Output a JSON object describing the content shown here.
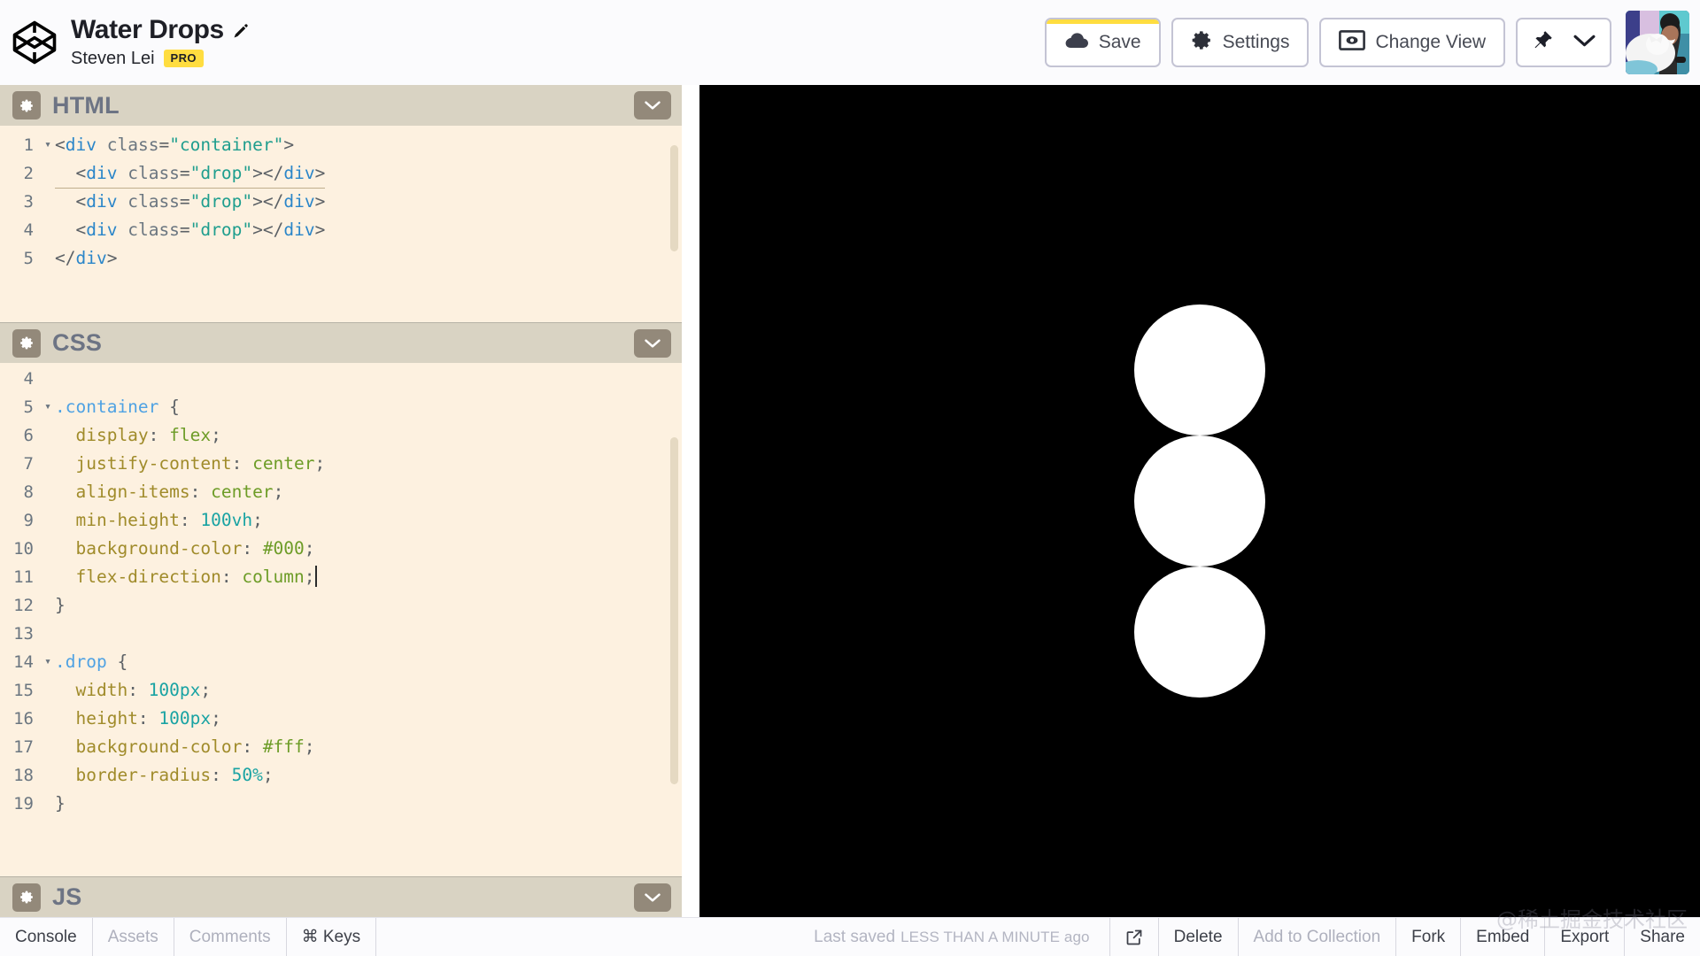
{
  "header": {
    "logo_icon": "codepen-logo-icon",
    "pen_title": "Water Drops",
    "edit_icon": "pencil-edit-icon",
    "author": "Steven Lei",
    "pro_badge": "PRO",
    "buttons": {
      "save": {
        "label": "Save",
        "icon": "cloud-icon",
        "unsaved_accent": "#ffdd40"
      },
      "settings": {
        "label": "Settings",
        "icon": "gear-icon"
      },
      "change_view": {
        "label": "Change View",
        "icon": "eye-in-frame-icon"
      },
      "pin": {
        "icon": "pin-icon",
        "chevron": "chevron-down-icon"
      }
    },
    "avatar_alt": "user-avatar"
  },
  "editors": [
    {
      "name": "HTML",
      "gear_icon": "gear-icon",
      "collapse_icon": "chevron-down-icon",
      "lines": [
        {
          "num": "1",
          "fold": "▾",
          "tokens": [
            {
              "t": "punct",
              "v": "<"
            },
            {
              "t": "tag",
              "v": "div"
            },
            {
              "t": "punct",
              "v": " "
            },
            {
              "t": "attr",
              "v": "class"
            },
            {
              "t": "punct",
              "v": "="
            },
            {
              "t": "str",
              "v": "\"container\""
            },
            {
              "t": "punct",
              "v": ">"
            }
          ]
        },
        {
          "num": "2",
          "fold": "",
          "underline": true,
          "tokens": [
            {
              "t": "punct",
              "v": "  <"
            },
            {
              "t": "tag",
              "v": "div"
            },
            {
              "t": "punct",
              "v": " "
            },
            {
              "t": "attr",
              "v": "class"
            },
            {
              "t": "punct",
              "v": "="
            },
            {
              "t": "str",
              "v": "\"drop\""
            },
            {
              "t": "punct",
              "v": "></"
            },
            {
              "t": "tag",
              "v": "div"
            },
            {
              "t": "punct",
              "v": ">"
            }
          ]
        },
        {
          "num": "3",
          "fold": "",
          "tokens": [
            {
              "t": "punct",
              "v": "  <"
            },
            {
              "t": "tag",
              "v": "div"
            },
            {
              "t": "punct",
              "v": " "
            },
            {
              "t": "attr",
              "v": "class"
            },
            {
              "t": "punct",
              "v": "="
            },
            {
              "t": "str",
              "v": "\"drop\""
            },
            {
              "t": "punct",
              "v": "></"
            },
            {
              "t": "tag",
              "v": "div"
            },
            {
              "t": "punct",
              "v": ">"
            }
          ]
        },
        {
          "num": "4",
          "fold": "",
          "tokens": [
            {
              "t": "punct",
              "v": "  <"
            },
            {
              "t": "tag",
              "v": "div"
            },
            {
              "t": "punct",
              "v": " "
            },
            {
              "t": "attr",
              "v": "class"
            },
            {
              "t": "punct",
              "v": "="
            },
            {
              "t": "str",
              "v": "\"drop\""
            },
            {
              "t": "punct",
              "v": "></"
            },
            {
              "t": "tag",
              "v": "div"
            },
            {
              "t": "punct",
              "v": ">"
            }
          ]
        },
        {
          "num": "5",
          "fold": "",
          "tokens": [
            {
              "t": "punct",
              "v": "</"
            },
            {
              "t": "tag",
              "v": "div"
            },
            {
              "t": "punct",
              "v": ">"
            }
          ]
        }
      ]
    },
    {
      "name": "CSS",
      "gear_icon": "gear-icon",
      "collapse_icon": "chevron-down-icon",
      "lines": [
        {
          "num": "4",
          "fold": "",
          "tokens": []
        },
        {
          "num": "5",
          "fold": "▾",
          "tokens": [
            {
              "t": "sel",
              "v": ".container"
            },
            {
              "t": "punct",
              "v": " {"
            }
          ]
        },
        {
          "num": "6",
          "fold": "",
          "tokens": [
            {
              "t": "prop",
              "v": "  display"
            },
            {
              "t": "punct",
              "v": ": "
            },
            {
              "t": "val",
              "v": "flex"
            },
            {
              "t": "punct",
              "v": ";"
            }
          ]
        },
        {
          "num": "7",
          "fold": "",
          "tokens": [
            {
              "t": "prop",
              "v": "  justify-content"
            },
            {
              "t": "punct",
              "v": ": "
            },
            {
              "t": "val",
              "v": "center"
            },
            {
              "t": "punct",
              "v": ";"
            }
          ]
        },
        {
          "num": "8",
          "fold": "",
          "tokens": [
            {
              "t": "prop",
              "v": "  align-items"
            },
            {
              "t": "punct",
              "v": ": "
            },
            {
              "t": "val",
              "v": "center"
            },
            {
              "t": "punct",
              "v": ";"
            }
          ]
        },
        {
          "num": "9",
          "fold": "",
          "tokens": [
            {
              "t": "prop",
              "v": "  min-height"
            },
            {
              "t": "punct",
              "v": ": "
            },
            {
              "t": "num",
              "v": "100vh"
            },
            {
              "t": "punct",
              "v": ";"
            }
          ]
        },
        {
          "num": "10",
          "fold": "",
          "tokens": [
            {
              "t": "prop",
              "v": "  background-color"
            },
            {
              "t": "punct",
              "v": ": "
            },
            {
              "t": "val",
              "v": "#000"
            },
            {
              "t": "punct",
              "v": ";"
            }
          ]
        },
        {
          "num": "11",
          "fold": "",
          "caret": true,
          "tokens": [
            {
              "t": "prop",
              "v": "  flex-direction"
            },
            {
              "t": "punct",
              "v": ": "
            },
            {
              "t": "val",
              "v": "column"
            },
            {
              "t": "punct",
              "v": ";"
            }
          ]
        },
        {
          "num": "12",
          "fold": "",
          "tokens": [
            {
              "t": "punct",
              "v": "}"
            }
          ]
        },
        {
          "num": "13",
          "fold": "",
          "tokens": []
        },
        {
          "num": "14",
          "fold": "▾",
          "tokens": [
            {
              "t": "sel",
              "v": ".drop"
            },
            {
              "t": "punct",
              "v": " {"
            }
          ]
        },
        {
          "num": "15",
          "fold": "",
          "tokens": [
            {
              "t": "prop",
              "v": "  width"
            },
            {
              "t": "punct",
              "v": ": "
            },
            {
              "t": "num",
              "v": "100px"
            },
            {
              "t": "punct",
              "v": ";"
            }
          ]
        },
        {
          "num": "16",
          "fold": "",
          "tokens": [
            {
              "t": "prop",
              "v": "  height"
            },
            {
              "t": "punct",
              "v": ": "
            },
            {
              "t": "num",
              "v": "100px"
            },
            {
              "t": "punct",
              "v": ";"
            }
          ]
        },
        {
          "num": "17",
          "fold": "",
          "tokens": [
            {
              "t": "prop",
              "v": "  background-color"
            },
            {
              "t": "punct",
              "v": ": "
            },
            {
              "t": "val",
              "v": "#fff"
            },
            {
              "t": "punct",
              "v": ";"
            }
          ]
        },
        {
          "num": "18",
          "fold": "",
          "tokens": [
            {
              "t": "prop",
              "v": "  border-radius"
            },
            {
              "t": "punct",
              "v": ": "
            },
            {
              "t": "num",
              "v": "50%"
            },
            {
              "t": "punct",
              "v": ";"
            }
          ]
        },
        {
          "num": "19",
          "fold": "",
          "tokens": [
            {
              "t": "punct",
              "v": "}"
            }
          ]
        }
      ]
    },
    {
      "name": "JS",
      "gear_icon": "gear-icon",
      "collapse_icon": "chevron-down-icon",
      "lines": []
    }
  ],
  "preview": {
    "background": "#000000",
    "drop_color": "#ffffff",
    "drop_count": 3
  },
  "bottombar": {
    "left_items": [
      {
        "label": "Console",
        "muted": false
      },
      {
        "label": "Assets",
        "muted": true
      },
      {
        "label": "Comments",
        "muted": true
      },
      {
        "label": "⌘ Keys",
        "muted": false
      }
    ],
    "saved_prefix": "Last saved",
    "saved_caps": "LESS THAN A MINUTE ago",
    "right_items": [
      {
        "label": "Delete",
        "muted": false
      },
      {
        "label": "Add to Collection",
        "muted": true
      },
      {
        "label": "Fork",
        "muted": false
      },
      {
        "label": "Embed",
        "muted": false
      },
      {
        "label": "Export",
        "muted": false
      },
      {
        "label": "Share",
        "muted": false
      }
    ],
    "open_external_icon": "external-link-icon"
  },
  "watermark": "@稀土掘金技术社区"
}
